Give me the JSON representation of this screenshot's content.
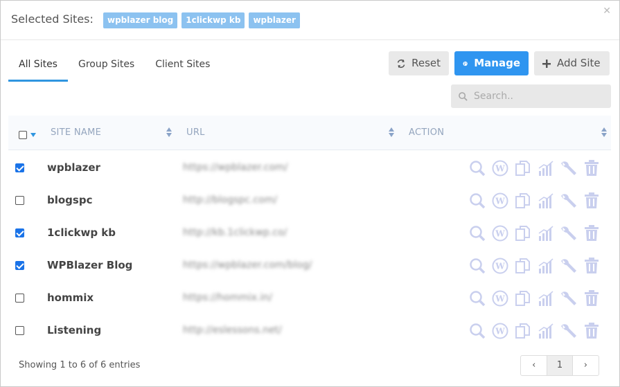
{
  "header": {
    "title": "Selected Sites:",
    "chips": [
      "wpblazer blog",
      "1clickwp kb",
      "wpblazer"
    ],
    "close_icon": "close-icon"
  },
  "tabs": [
    {
      "label": "All Sites",
      "active": true
    },
    {
      "label": "Group Sites",
      "active": false
    },
    {
      "label": "Client Sites",
      "active": false
    }
  ],
  "toolbar": {
    "reset_label": "Reset",
    "manage_label": "Manage",
    "add_label": "Add Site"
  },
  "search": {
    "placeholder": "Search.."
  },
  "table": {
    "columns": [
      "SITE NAME",
      "URL",
      "ACTION"
    ],
    "rows": [
      {
        "checked": true,
        "name": "wpblazer",
        "url": "https://wpblazer.com/"
      },
      {
        "checked": false,
        "name": "blogspc",
        "url": "http://blogspc.com/"
      },
      {
        "checked": true,
        "name": "1clickwp kb",
        "url": "http://kb.1clickwp.co/"
      },
      {
        "checked": true,
        "name": "WPBlazer Blog",
        "url": "https://wpblazer.com/blog/"
      },
      {
        "checked": false,
        "name": "hommix",
        "url": "https://hommix.in/"
      },
      {
        "checked": false,
        "name": "Listening",
        "url": "http://eslessons.net/"
      }
    ],
    "action_icons": [
      "magnifier-icon",
      "wordpress-icon",
      "copy-icon",
      "stats-icon",
      "wrench-icon",
      "trash-icon"
    ]
  },
  "footer": {
    "info": "Showing 1 to 6 of 6 entries",
    "pages": [
      "‹",
      "1",
      "›"
    ]
  },
  "colors": {
    "accent": "#2f95f0",
    "chip": "#8cc2f0",
    "action_icon": "#c9cfee"
  }
}
